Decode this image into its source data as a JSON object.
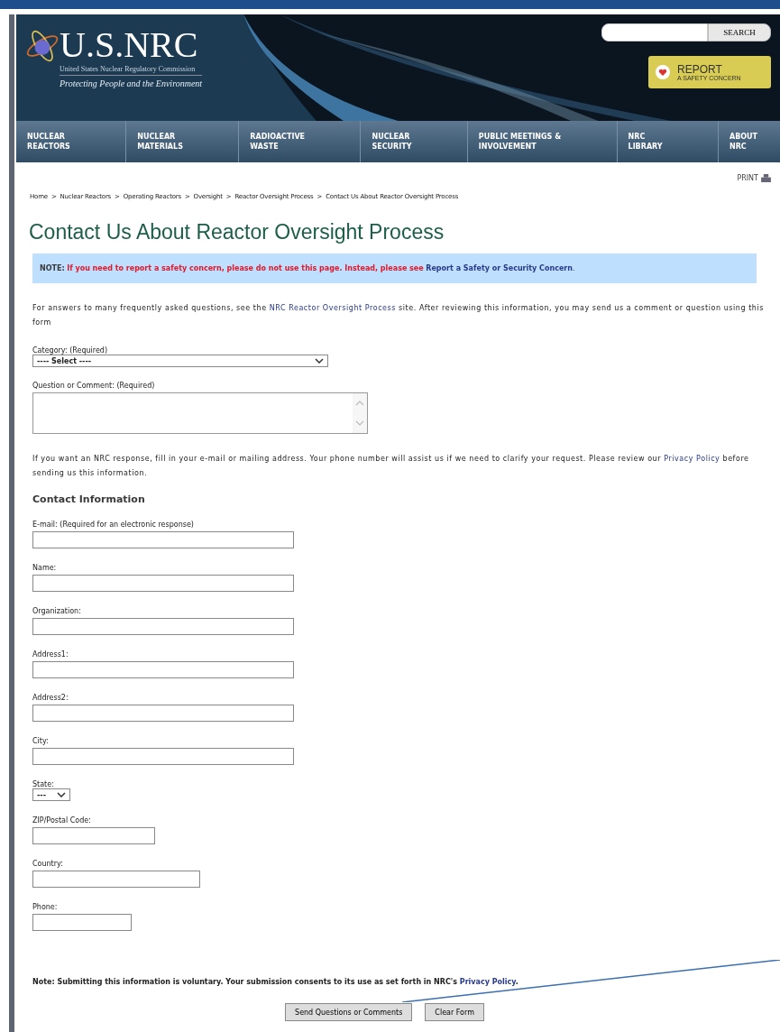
{
  "header": {
    "logo": "U.S.NRC",
    "agency": "United States Nuclear Regulatory Commission",
    "tagline": "Protecting People and the Environment",
    "search_button": "SEARCH",
    "report": {
      "title": "REPORT",
      "subtitle": "A SAFETY CONCERN"
    }
  },
  "nav": [
    {
      "line1": "NUCLEAR",
      "line2": "REACTORS"
    },
    {
      "line1": "NUCLEAR",
      "line2": "MATERIALS"
    },
    {
      "line1": "RADIOACTIVE",
      "line2": "WASTE"
    },
    {
      "line1": "NUCLEAR",
      "line2": "SECURITY"
    },
    {
      "line1": "PUBLIC MEETINGS &",
      "line2": "INVOLVEMENT"
    },
    {
      "line1": "NRC",
      "line2": "LIBRARY"
    },
    {
      "line1": "ABOUT",
      "line2": "NRC"
    }
  ],
  "print": "PRINT",
  "breadcrumb_separator": ">",
  "breadcrumb": [
    "Home",
    "Nuclear Reactors",
    "Operating Reactors",
    "Oversight",
    "Reactor Oversight Process",
    "Contact Us About Reactor Oversight Process"
  ],
  "title": "Contact Us About Reactor Oversight Process",
  "note": {
    "label": "NOTE:",
    "text": "If you need to report a safety concern, please do not use this page. Instead, please see",
    "link": "Report a Safety or Security Concern",
    "end": "."
  },
  "intro": {
    "before": "For answers to many frequently asked questions, see the",
    "link": "NRC Reactor Oversight Process",
    "after": "site. After reviewing this information, you may send us a comment or question using this form"
  },
  "category": {
    "label": "Category: (Required)",
    "value": "---- Select ----"
  },
  "comment": {
    "label": "Question or Comment: (Required)"
  },
  "response_note": {
    "before": "If you want an NRC response, fill in your e-mail or mailing address. Your phone number will assist us if we need to clarify your request. Please review our",
    "link": "Privacy Policy",
    "after": "before sending us this information."
  },
  "contact_heading": "Contact Information",
  "fields": [
    {
      "kind": "text",
      "label": "E-mail: (Required for an electronic response)"
    },
    {
      "kind": "text",
      "label": "Name:"
    },
    {
      "kind": "text",
      "label": "Organization:"
    },
    {
      "kind": "text",
      "label": "Address1:"
    },
    {
      "kind": "text",
      "label": "Address2:"
    },
    {
      "kind": "text",
      "label": "City:"
    },
    {
      "kind": "select",
      "label": "State:",
      "value": "---"
    },
    {
      "kind": "text",
      "label": "ZIP/Postal Code:"
    },
    {
      "kind": "text",
      "label": "Country:"
    },
    {
      "kind": "text",
      "label": "Phone:"
    }
  ],
  "footer_note": {
    "before": "Note: Submitting this information is voluntary. Your submission consents to its use as set forth in NRC's",
    "link": "Privacy Policy",
    "end": "."
  },
  "buttons": [
    "Send Questions or Comments",
    "Clear Form"
  ]
}
